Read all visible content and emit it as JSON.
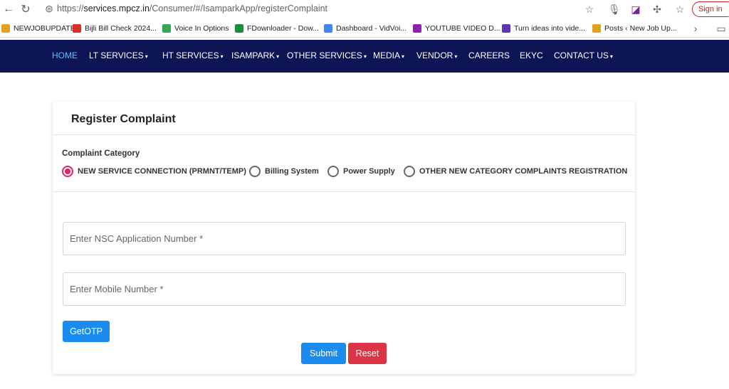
{
  "browser": {
    "url_prefix": "https://",
    "url_host": "services.mpcz.in",
    "url_path": "/Consumer/#/IsamparkApp/registerComplaint",
    "signin_label": "Sign in",
    "bookmarks": [
      {
        "label": "NEWJOBUPDATE",
        "color": "#e0a020"
      },
      {
        "label": "Bijli Bill Check 2024...",
        "color": "#d93025"
      },
      {
        "label": "Voice In Options",
        "color": "#34a853"
      },
      {
        "label": "FDownloader - Dow...",
        "color": "#1e8e3e"
      },
      {
        "label": "Dashboard - VidVoi...",
        "color": "#4285f4"
      },
      {
        "label": "YOUTUBE VIDEO D...",
        "color": "#8e24aa"
      },
      {
        "label": "Turn ideas into vide...",
        "color": "#5e35b1"
      },
      {
        "label": "Posts ‹ New Job Up...",
        "color": "#e0a020"
      }
    ]
  },
  "nav": {
    "items": [
      {
        "label": "HOME",
        "caret": ""
      },
      {
        "label": "LT SERVICES",
        "caret": "▾"
      },
      {
        "label": "HT SERVICES",
        "caret": "▾"
      },
      {
        "label": "ISAMPARK",
        "caret": "▾"
      },
      {
        "label": "OTHER SERVICES",
        "caret": "▾"
      },
      {
        "label": "MEDIA",
        "caret": "▾"
      },
      {
        "label": "VENDOR",
        "caret": "▾"
      },
      {
        "label": "CAREERS",
        "caret": ""
      },
      {
        "label": "EKYC",
        "caret": ""
      },
      {
        "label": "CONTACT US",
        "caret": "▾"
      }
    ],
    "active_color": "#5bc0ff",
    "bg_color": "#0d1555"
  },
  "form": {
    "title": "Register Complaint",
    "category_label": "Complaint Category",
    "categories": [
      {
        "label": "NEW SERVICE CONNECTION (PRMNT/TEMP)",
        "checked": true
      },
      {
        "label": "Billing System",
        "checked": false
      },
      {
        "label": "Power Supply",
        "checked": false
      },
      {
        "label": "OTHER NEW CATEGORY COMPLAINTS REGISTRATION",
        "checked": false
      }
    ],
    "nsc_placeholder": "Enter NSC Application Number *",
    "nsc_value": "",
    "mobile_placeholder": "Enter Mobile Number *",
    "mobile_value": "",
    "getotp_label": "GetOTP",
    "submit_label": "Submit",
    "reset_label": "Reset"
  }
}
